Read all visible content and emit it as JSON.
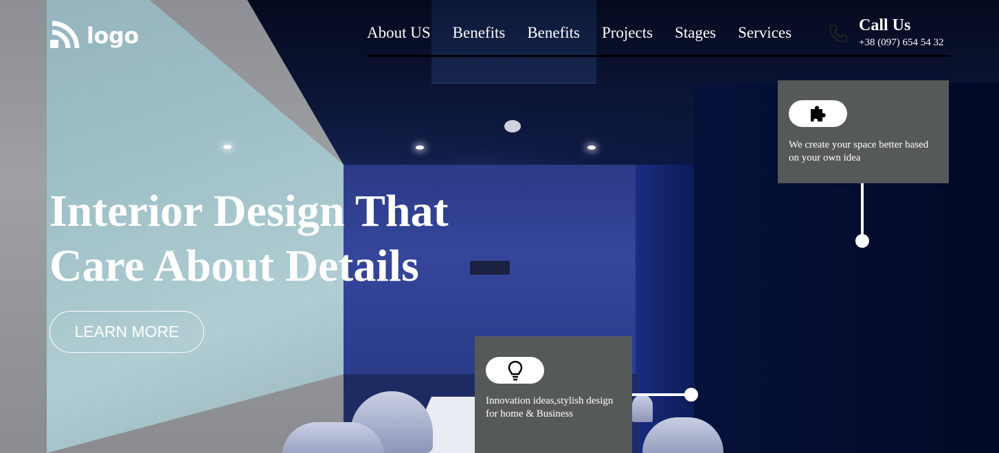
{
  "header": {
    "logo_text": "logo",
    "nav": [
      "About US",
      "Benefits",
      "Benefits",
      "Projects",
      "Stages",
      "Services"
    ],
    "call_title": "Call Us",
    "call_number": "+38 (097) 654 54 32"
  },
  "hero": {
    "title_line1": "Interior Design That",
    "title_line2": "Care About Details",
    "cta": "LEARN MORE"
  },
  "features": [
    {
      "icon": "puzzle-icon",
      "text": "We create your space better based on your own idea"
    },
    {
      "icon": "lightbulb-icon",
      "text_line1": "Innovation ideas,stylish design",
      "text_line2": "for home & Business"
    }
  ],
  "colors": {
    "card_bg": "#555a58",
    "text": "#ffffff",
    "nav_underline": "#000000"
  }
}
